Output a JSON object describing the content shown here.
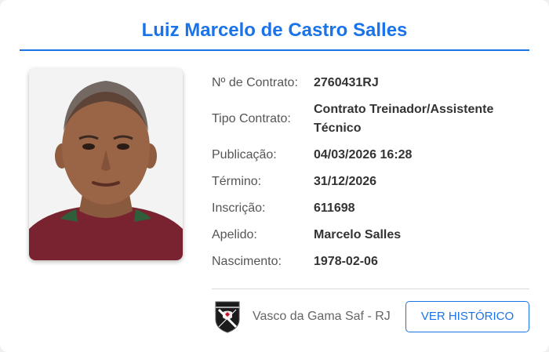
{
  "profile": {
    "name": "Luiz Marcelo de Castro Salles",
    "photo_icon": "person-portrait-photo"
  },
  "fields": [
    {
      "label": "Nº de Contrato:",
      "value": "2760431RJ"
    },
    {
      "label": "Tipo Contrato:",
      "value": "Contrato Treinador/Assistente Técnico"
    },
    {
      "label": "Publicação:",
      "value": "04/03/2026 16:28"
    },
    {
      "label": "Término:",
      "value": "31/12/2026"
    },
    {
      "label": "Inscrição:",
      "value": "611698"
    },
    {
      "label": "Apelido:",
      "value": "Marcelo Salles"
    },
    {
      "label": "Nascimento:",
      "value": "1978-02-06"
    }
  ],
  "club": {
    "name": "Vasco da Gama Saf - RJ",
    "logo_icon": "vasco-crest-icon"
  },
  "actions": {
    "history_label": "VER HISTÓRICO"
  },
  "colors": {
    "accent": "#1a73e8",
    "label_text": "#555555",
    "value_text": "#333333",
    "shirt": "#7a2330"
  }
}
